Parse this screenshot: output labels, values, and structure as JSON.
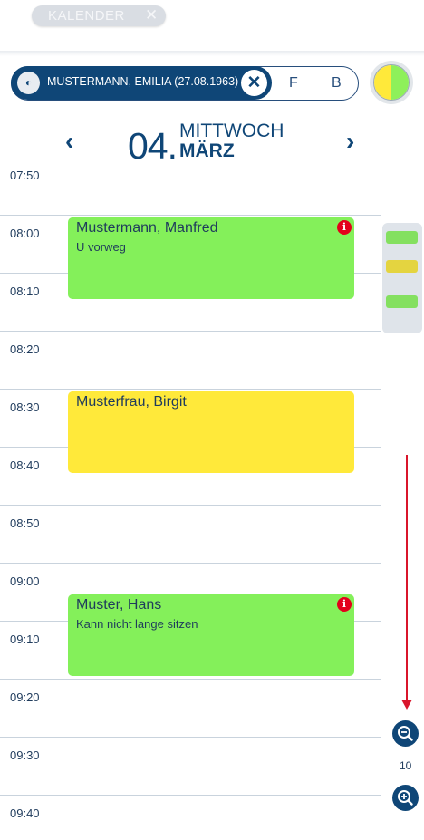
{
  "top_tab": {
    "label": "KALENDER",
    "close_glyph": "✕"
  },
  "patient": {
    "avatar_glyph": "◐",
    "name": "MUSTERMANN, EMILIA (27.08.1963)",
    "close_glyph": "✕",
    "flags": [
      "F",
      "B"
    ],
    "status_colors": [
      "#ffe93a",
      "#8ef05a"
    ]
  },
  "date": {
    "day": "04.",
    "weekday": "MITTWOCH",
    "month": "MÄRZ",
    "prev_glyph": "‹",
    "next_glyph": "›"
  },
  "timeslots": [
    "07:50",
    "08:00",
    "08:10",
    "08:20",
    "08:30",
    "08:40",
    "08:50",
    "09:00",
    "09:10",
    "09:20",
    "09:30",
    "09:40"
  ],
  "appointments": [
    {
      "name": "Mustermann, Manfred",
      "note": "U vorweg",
      "color": "#84f05a",
      "info": "i",
      "has_info": true
    },
    {
      "name": "Musterfrau, Birgit",
      "note": "",
      "color": "#ffe93a",
      "info": "",
      "has_info": false
    },
    {
      "name": "Muster, Hans",
      "note": "Kann nicht lange sitzen",
      "color": "#84f05a",
      "info": "i",
      "has_info": true
    }
  ],
  "minimap_colors": [
    "#84e060",
    "#e4d440",
    "#84e060"
  ],
  "zoom": {
    "level": "10",
    "out_icon": "zoom-out-icon",
    "in_icon": "zoom-in-icon"
  },
  "colors": {
    "primary": "#0f4677",
    "grid_line": "#c9d3dd",
    "alert": "#e3001b",
    "scroll_arrow": "#d9152b"
  }
}
